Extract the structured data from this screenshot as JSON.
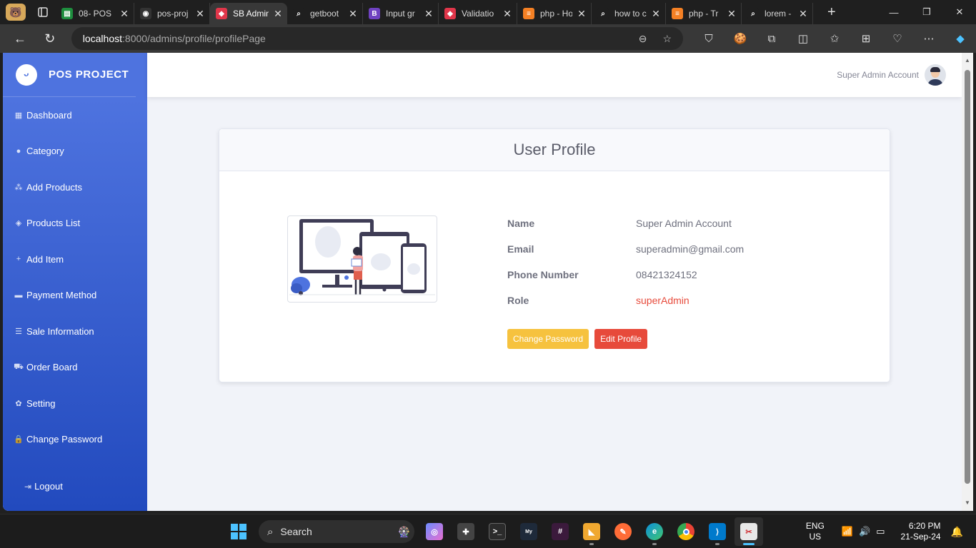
{
  "browser": {
    "tabs": [
      {
        "title": "08- POS",
        "color": "#1e8e3e",
        "glyph": "▤"
      },
      {
        "title": "pos-proj",
        "color": "#333333",
        "glyph": "◉"
      },
      {
        "title": "SB Admin",
        "color": "#e0364a",
        "glyph": "◆"
      },
      {
        "title": "getboot",
        "color": "#1f1f1f",
        "glyph": "⌕"
      },
      {
        "title": "Input gr",
        "color": "#6f42c1",
        "glyph": "B"
      },
      {
        "title": "Validatio",
        "color": "#e0364a",
        "glyph": "◆"
      },
      {
        "title": "php - Ho",
        "color": "#f48024",
        "glyph": "≡"
      },
      {
        "title": "how to c",
        "color": "#1f1f1f",
        "glyph": "⌕"
      },
      {
        "title": "php - Tr",
        "color": "#f48024",
        "glyph": "≡"
      },
      {
        "title": "lorem - S",
        "color": "#1f1f1f",
        "glyph": "⌕"
      }
    ],
    "url_host": "localhost",
    "url_path": ":8000/admins/profile/profilePage"
  },
  "sidebar": {
    "brand": "POS PROJECT",
    "items": [
      {
        "label": "Dashboard",
        "icon": "▦"
      },
      {
        "label": "Category",
        "icon": "●"
      },
      {
        "label": "Add Products",
        "icon": "⁂"
      },
      {
        "label": "Products List",
        "icon": "◈"
      },
      {
        "label": "Add Item",
        "icon": "+"
      },
      {
        "label": "Payment Method",
        "icon": "▬"
      },
      {
        "label": "Sale Information",
        "icon": "☰"
      },
      {
        "label": "Order Board",
        "icon": "⛟"
      },
      {
        "label": "Setting",
        "icon": "✿"
      },
      {
        "label": "Change Password",
        "icon": "🔒"
      }
    ],
    "logout": "Logout"
  },
  "topbar": {
    "user_name": "Super Admin Account"
  },
  "profile": {
    "title": "User Profile",
    "fields": [
      {
        "label": "Name",
        "value": "Super Admin Account"
      },
      {
        "label": "Email",
        "value": "superadmin@gmail.com"
      },
      {
        "label": "Phone Number",
        "value": "08421324152"
      },
      {
        "label": "Role",
        "value": "superAdmin"
      }
    ],
    "change_password_label": "Change Password",
    "edit_profile_label": "Edit Profile"
  },
  "taskbar": {
    "search_label": "Search",
    "lang_top": "ENG",
    "lang_bottom": "US",
    "time": "6:20 PM",
    "date": "21-Sep-24"
  },
  "colors": {
    "primary": "#4e73df",
    "warning": "#f6c23e",
    "danger": "#e74a3b"
  }
}
